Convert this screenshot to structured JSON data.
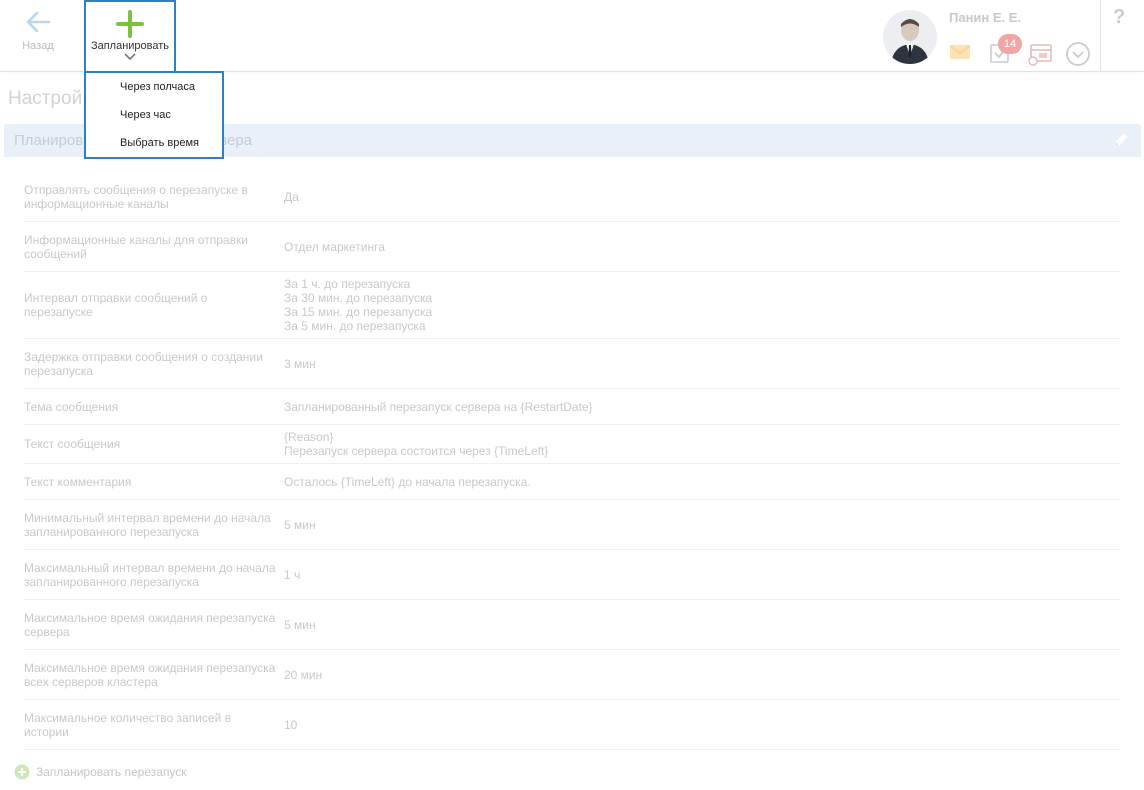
{
  "topbar": {
    "back_label": "Назад",
    "plan_label": "Запланировать",
    "user_name": "Панин Е. Е.",
    "tasks_badge": "14",
    "help_label": "?"
  },
  "dropdown": {
    "items": [
      "Через полчаса",
      "Через час",
      "Выбрать время"
    ]
  },
  "page": {
    "title": "Настрой",
    "card_title": "Планиров"
  },
  "card_title_tail": "вера",
  "settings": [
    {
      "key": "Отправлять сообщения о перезапуске в информационные каналы",
      "value": "Да"
    },
    {
      "key": "Информационные каналы для отправки сообщений",
      "value": "Отдел маркетинга"
    },
    {
      "key": "Интервал отправки сообщений о перезапуске",
      "value": "За 1 ч. до перезапуска\nЗа 30 мин. до перезапуска\nЗа 15 мин. до перезапуска\nЗа 5 мин. до перезапуска"
    },
    {
      "key": "Задержка отправки сообщения о создании перезапуска",
      "value": "3 мин"
    },
    {
      "key": "Тема сообщения",
      "value": "Запланированный перезапуск сервера на {RestartDate}"
    },
    {
      "key": "Текст сообщения",
      "value": "{Reason}\nПерезапуск сервера состоится через {TimeLeft}"
    },
    {
      "key": "Текст комментария",
      "value": "Осталось {TimeLeft} до начала перезапуска."
    },
    {
      "key": "Минимальный интервал времени до начала запланированного перезапуска",
      "value": "5 мин"
    },
    {
      "key": "Максимальный интервал времени до начала запланированного перезапуска",
      "value": "1 ч"
    },
    {
      "key": "Максимальное время ожидания перезапуска сервера",
      "value": "5 мин"
    },
    {
      "key": "Максимальное время ожидания перезапуска всех серверов кластера",
      "value": "20 мин"
    },
    {
      "key": "Максимальное количество записей в истории",
      "value": "10"
    }
  ],
  "footer": {
    "add_label": "Запланировать перезапуск"
  },
  "colors": {
    "accent_border": "#2f80c3",
    "plus_green": "#7cc23f",
    "badge": "#f2a5a5"
  }
}
